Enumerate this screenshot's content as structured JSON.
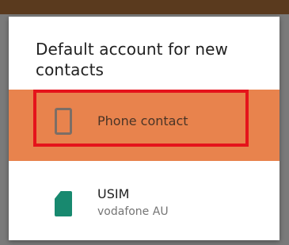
{
  "dialog": {
    "title": "Default account for new contacts",
    "options": [
      {
        "label": "Phone contact",
        "icon": "phone-icon",
        "selected": true
      },
      {
        "label": "USIM",
        "sublabel": "vodafone AU",
        "icon": "sim-card-icon"
      }
    ]
  },
  "colors": {
    "selected_row": "#e8834d",
    "highlight_border": "#e5141b",
    "sim_icon": "#18896f"
  }
}
